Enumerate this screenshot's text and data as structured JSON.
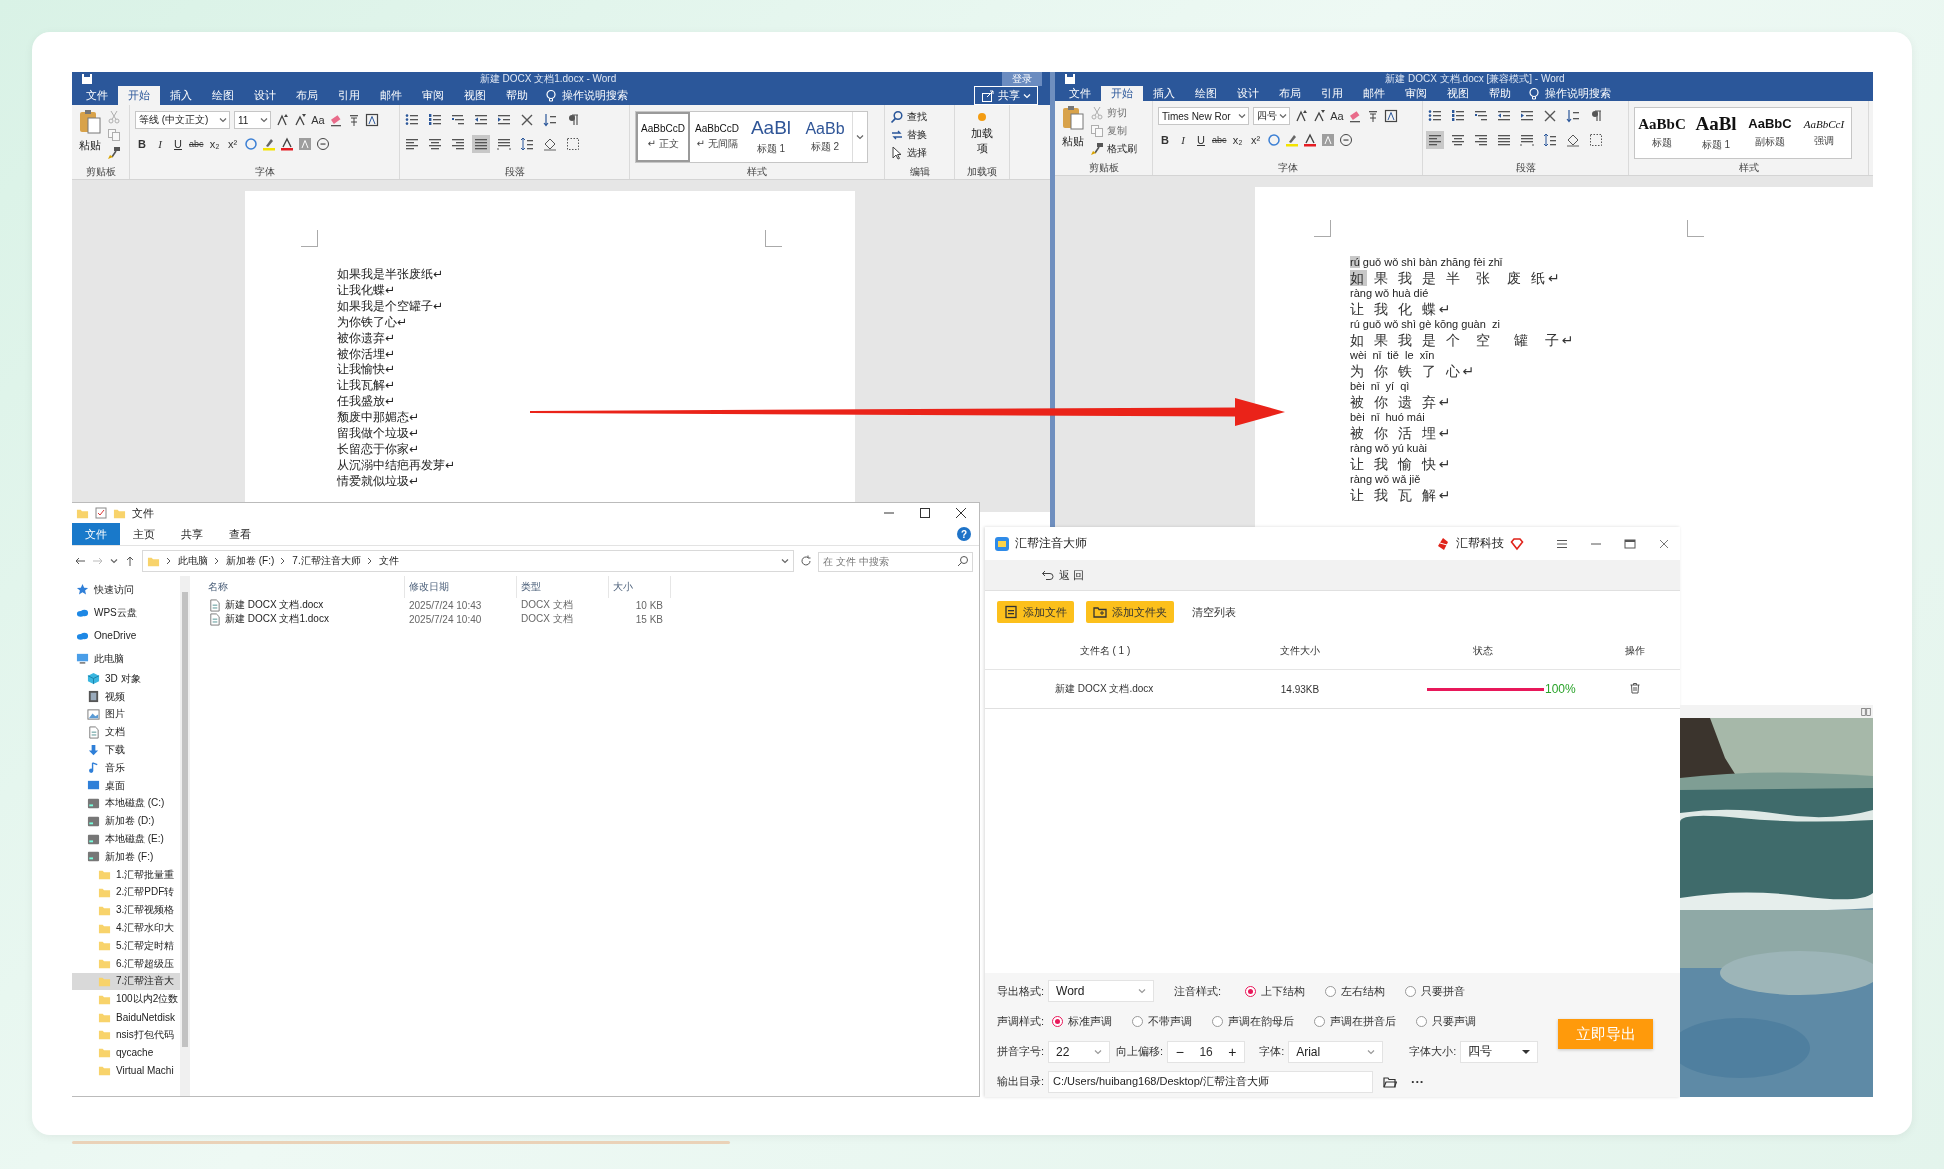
{
  "word_left": {
    "title": "新建 DOCX 文档1.docx - Word",
    "login": "登录",
    "tabs": [
      {
        "label": "文件",
        "selected": false
      },
      {
        "label": "开始",
        "selected": true
      },
      {
        "label": "插入",
        "selected": false
      },
      {
        "label": "绘图",
        "selected": false
      },
      {
        "label": "设计",
        "selected": false
      },
      {
        "label": "布局",
        "selected": false
      },
      {
        "label": "引用",
        "selected": false
      },
      {
        "label": "邮件",
        "selected": false
      },
      {
        "label": "审阅",
        "selected": false
      },
      {
        "label": "视图",
        "selected": false
      },
      {
        "label": "帮助",
        "selected": false
      }
    ],
    "tell_me": "操作说明搜索",
    "share": "共享",
    "clipboard": {
      "paste": "粘贴",
      "label": "剪贴板",
      "tools": [
        {
          "kind": "cut",
          "disabled": true
        },
        {
          "kind": "copy",
          "disabled": true
        },
        {
          "kind": "painter",
          "disabled": false
        }
      ]
    },
    "font": {
      "name": "等线 (中文正文)",
      "size": "11",
      "case": "Aa",
      "format_buttons": [
        "B",
        "I",
        "U",
        "abc",
        "x₂",
        "x²"
      ],
      "label": "字体"
    },
    "paragraph": {
      "label": "段落"
    },
    "styles": {
      "label": "样式",
      "items": [
        {
          "preview": "AaBbCcD",
          "name": "↵ 正文",
          "kind": "body",
          "selected": true
        },
        {
          "preview": "AaBbCcD",
          "name": "↵ 无间隔",
          "kind": "body",
          "selected": false
        },
        {
          "preview": "AaBl",
          "name": "标题 1",
          "kind": "heading1",
          "selected": false
        },
        {
          "preview": "AaBb",
          "name": "标题 2",
          "kind": "heading2",
          "selected": false
        }
      ]
    },
    "editing": {
      "label": "编辑",
      "items": [
        {
          "label": "查找",
          "kind": "search"
        },
        {
          "label": "替换",
          "kind": "replace"
        },
        {
          "label": "选择",
          "kind": "select"
        }
      ]
    },
    "addins": {
      "button": "加载项",
      "label": "加载项"
    },
    "lines": [
      "如果我是半张废纸↵",
      "让我化蝶↵",
      "如果我是个空罐子↵",
      "为你铁了心↵",
      "被你遗弃↵",
      "被你活埋↵",
      "让我愉快↵",
      "让我瓦解↵",
      "任我盛放↵",
      "颓废中那媚态↵",
      "留我做个垃圾↵",
      "长留恋于你家↵",
      "从沉溺中结疤再发芽↵",
      "情爱就似垃圾↵"
    ]
  },
  "word_right": {
    "title": "新建 DOCX 文档.docx [兼容模式] - Word",
    "tabs": [
      {
        "label": "文件",
        "selected": false
      },
      {
        "label": "开始",
        "selected": true
      },
      {
        "label": "插入",
        "selected": false
      },
      {
        "label": "绘图",
        "selected": false
      },
      {
        "label": "设计",
        "selected": false
      },
      {
        "label": "布局",
        "selected": false
      },
      {
        "label": "引用",
        "selected": false
      },
      {
        "label": "邮件",
        "selected": false
      },
      {
        "label": "审阅",
        "selected": false
      },
      {
        "label": "视图",
        "selected": false
      },
      {
        "label": "帮助",
        "selected": false
      }
    ],
    "tell_me": "操作说明搜索",
    "clipboard": {
      "paste": "粘贴",
      "label": "剪贴板",
      "tools": [
        {
          "kind": "cut",
          "label": "剪切",
          "disabled": true
        },
        {
          "kind": "copy",
          "label": "复制",
          "disabled": true
        },
        {
          "kind": "painter",
          "label": "格式刷",
          "disabled": false
        }
      ]
    },
    "font": {
      "name": "Times New Ror",
      "size": "四号",
      "case": "Aa",
      "format_buttons": [
        "B",
        "I",
        "U",
        "abc",
        "x₂",
        "x²"
      ],
      "label": "字体"
    },
    "paragraph": {
      "label": "段落"
    },
    "styles": {
      "label": "样式",
      "items": [
        {
          "preview": "AaBbC",
          "name": "标题",
          "kind": "title",
          "selected": false
        },
        {
          "preview": "AaBl",
          "name": "标题 1",
          "kind": "title-large",
          "selected": false
        },
        {
          "preview": "AaBbC",
          "name": "副标题",
          "kind": "subtitle",
          "selected": false
        },
        {
          "preview": "AaBbCcI",
          "name": "强调",
          "kind": "emphasis",
          "selected": false
        }
      ]
    },
    "pairs": [
      {
        "pinyin": "rú guǒ wǒ shì bàn zhāng fèi zhǐ",
        "hanzi": "如 果 我 是 半  张  废 纸↵",
        "highlighted": true
      },
      {
        "pinyin": "ràng wǒ huà dié",
        "hanzi": "让 我 化 蝶↵",
        "highlighted": false
      },
      {
        "pinyin": "rú guǒ wǒ shì gè kōng guàn  zi",
        "hanzi": "如 果 我 是 个  空   罐  子↵",
        "highlighted": false
      },
      {
        "pinyin": "wèi  nǐ  tiě  le  xīn",
        "hanzi": "为 你 铁 了 心↵",
        "highlighted": false
      },
      {
        "pinyin": "bèi  nǐ  yí  qì",
        "hanzi": "被 你 遗 弃↵",
        "highlighted": false
      },
      {
        "pinyin": "bèi  nǐ  huó mái",
        "hanzi": "被 你 活 埋↵",
        "highlighted": false
      },
      {
        "pinyin": "ràng wǒ yú kuài",
        "hanzi": "让 我 愉 快↵",
        "highlighted": false
      },
      {
        "pinyin": "ràng wǒ wǎ jiě",
        "hanzi": "让 我 瓦 解↵",
        "highlighted": false
      }
    ]
  },
  "explorer": {
    "title": "文件",
    "help": "?",
    "tabs": [
      {
        "label": "文件",
        "selected": true
      },
      {
        "label": "主页",
        "selected": false
      },
      {
        "label": "共享",
        "selected": false
      },
      {
        "label": "查看",
        "selected": false
      }
    ],
    "path": [
      "此电脑",
      "新加卷 (F:)",
      "7.汇帮注音大师",
      "文件"
    ],
    "search": {
      "placeholder": "在 文件 中搜索"
    },
    "nav": [
      {
        "label": "快速访问",
        "kind": "star",
        "selected": false
      },
      {
        "label": "WPS云盘",
        "kind": "cloud",
        "selected": false
      },
      {
        "label": "OneDrive",
        "kind": "cloud",
        "selected": false
      },
      {
        "label": "此电脑",
        "kind": "pc",
        "selected": false,
        "children": [
          {
            "label": "3D 对象",
            "kind": "cube",
            "selected": false
          },
          {
            "label": "视频",
            "kind": "video",
            "selected": false
          },
          {
            "label": "图片",
            "kind": "picture",
            "selected": false
          },
          {
            "label": "文档",
            "kind": "document",
            "selected": false
          },
          {
            "label": "下载",
            "kind": "download",
            "selected": false
          },
          {
            "label": "音乐",
            "kind": "music",
            "selected": false
          },
          {
            "label": "桌面",
            "kind": "desktop",
            "selected": false
          },
          {
            "label": "本地磁盘 (C:)",
            "kind": "drive",
            "selected": false
          },
          {
            "label": "新加卷 (D:)",
            "kind": "drive",
            "selected": false
          },
          {
            "label": "本地磁盘 (E:)",
            "kind": "drive",
            "selected": false
          },
          {
            "label": "新加卷 (F:)",
            "kind": "drive",
            "selected": false,
            "children": [
              {
                "label": "1.汇帮批量重",
                "kind": "folder",
                "selected": false
              },
              {
                "label": "2.汇帮PDF转",
                "kind": "folder",
                "selected": false
              },
              {
                "label": "3.汇帮视频格",
                "kind": "folder",
                "selected": false
              },
              {
                "label": "4.汇帮水印大",
                "kind": "folder",
                "selected": false
              },
              {
                "label": "5.汇帮定时精",
                "kind": "folder",
                "selected": false
              },
              {
                "label": "6.汇帮超级压",
                "kind": "folder",
                "selected": false
              },
              {
                "label": "7.汇帮注音大",
                "kind": "folder",
                "selected": true
              },
              {
                "label": "100以内2位数",
                "kind": "folder",
                "selected": false
              },
              {
                "label": "BaiduNetdisk",
                "kind": "folder",
                "selected": false
              },
              {
                "label": "nsis打包代码",
                "kind": "folder",
                "selected": false
              },
              {
                "label": "qycache",
                "kind": "folder",
                "selected": false
              },
              {
                "label": "Virtual Machi",
                "kind": "folder",
                "selected": false
              }
            ]
          }
        ]
      }
    ],
    "columns": [
      "名称",
      "修改日期",
      "类型",
      "大小"
    ],
    "rows": [
      [
        "新建 DOCX 文档.docx",
        "2025/7/24 10:43",
        "DOCX 文档",
        "10 KB"
      ],
      [
        "新建 DOCX 文档1.docx",
        "2025/7/24 10:40",
        "DOCX 文档",
        "15 KB"
      ]
    ]
  },
  "app": {
    "title": "汇帮注音大师",
    "brand": "汇帮科技",
    "back": "返 回",
    "toolbar": [
      {
        "label": "添加文件",
        "kind": "file"
      },
      {
        "label": "添加文件夹",
        "kind": "folder"
      },
      {
        "label": "清空列表",
        "kind": "plain"
      }
    ],
    "columns": [
      "文件名 ( 1 )",
      "文件大小",
      "状态",
      "操作"
    ],
    "files": [
      {
        "name": "新建 DOCX 文档.docx",
        "size": "14.93KB",
        "level": 1,
        "percent": "100%"
      }
    ],
    "settings": {
      "export_format": {
        "label": "导出格式:",
        "value": "Word"
      },
      "annotation_style": {
        "label": "注音样式:",
        "options": [
          {
            "label": "上下结构",
            "selected": true
          },
          {
            "label": "左右结构",
            "selected": false
          },
          {
            "label": "只要拼音",
            "selected": false
          }
        ]
      },
      "tone_style": {
        "label": "声调样式:",
        "options": [
          {
            "label": "标准声调",
            "selected": true
          },
          {
            "label": "不带声调",
            "selected": false
          },
          {
            "label": "声调在韵母后",
            "selected": false
          },
          {
            "label": "声调在拼音后",
            "selected": false
          },
          {
            "label": "只要声调",
            "selected": false
          }
        ]
      },
      "pinyin_size": {
        "label": "拼音字号:",
        "value": "22"
      },
      "offset": {
        "label": "向上偏移:",
        "minus": "−",
        "value": "16",
        "plus": "+"
      },
      "font": {
        "label": "字体:",
        "value": "Arial"
      },
      "font_size": {
        "label": "字体大小:",
        "value": "四号"
      },
      "export_button": "立即导出",
      "output": {
        "label": "输出目录:",
        "value": "C:/Users/huibang168/Desktop/汇帮注音大师",
        "more": "···"
      }
    }
  }
}
